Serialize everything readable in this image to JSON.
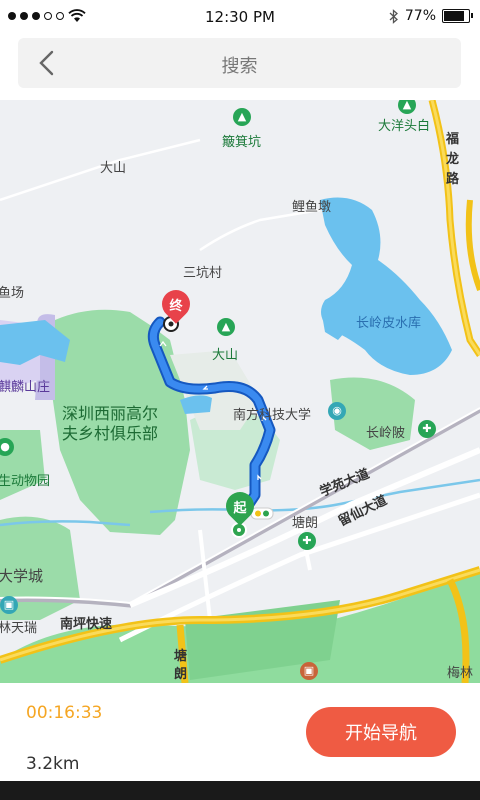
{
  "status_bar": {
    "time": "12:30 PM",
    "battery": "77%",
    "battery_level": 0.77
  },
  "header": {
    "title": "搜索"
  },
  "map": {
    "labels": {
      "dashan_small": "大山",
      "bojikeng": "簸箕坑",
      "dayangtoubai": "大洋头白",
      "fulong_road": "福龙路",
      "liyudun": "鲤鱼墩",
      "sankengcun": "三坑村",
      "yuchang": "鱼场",
      "dashan": "大山",
      "changling_reservoir": "长岭皮水库",
      "qilin_villa": "麒麟山庄",
      "golf_club_line1": "深圳西丽高尔",
      "golf_club_line2": "夫乡村俱乐部",
      "sustech": "南方科技大学",
      "changlingpi": "长岭陂",
      "zoo": "生动物园",
      "xueyuan_road": "学苑大道",
      "liuxian_road": "留仙大道",
      "tanglang": "塘朗",
      "university_city": "大学城",
      "lintianrui": "林天瑞",
      "nanping_express": "南坪快速",
      "tanglang_bottom": "塘朗",
      "meilin": "梅林"
    },
    "end_marker": "终",
    "start_marker": "起"
  },
  "route": {
    "duration": "00:16:33",
    "distance": "3.2km",
    "start_button": "开始导航"
  },
  "colors": {
    "accent": "#ef5b43",
    "duration": "#f5a623",
    "route": "#1a73e8"
  }
}
